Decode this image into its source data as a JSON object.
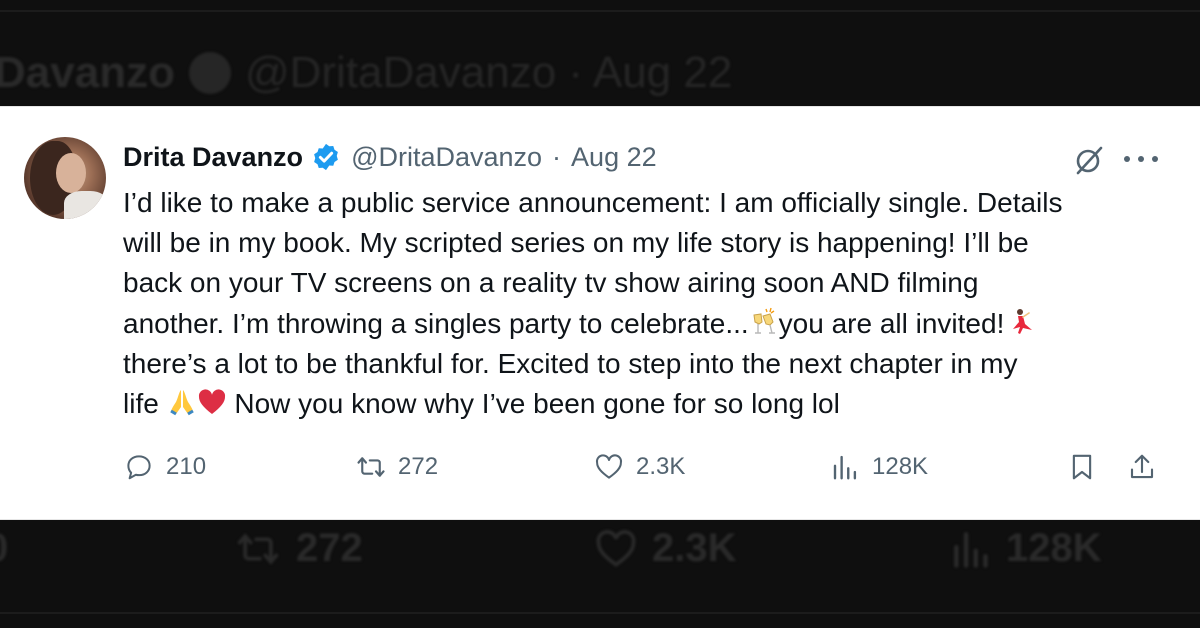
{
  "background": {
    "top_name_fragment": "Davanzo",
    "top_handle_date": "@DritaDavanzo · Aug 22",
    "bottom_reply_fragment": "0",
    "bottom_retweets": "272",
    "bottom_likes": "2.3K",
    "bottom_views": "128K"
  },
  "tweet": {
    "author_name": "Drita Davanzo",
    "handle": "@DritaDavanzo",
    "separator": "·",
    "date": "Aug 22",
    "lines": [
      "I’d like to make a public service announcement: I am officially single. Details",
      "will be in my book. My scripted series on my life story is happening! I’ll be",
      "back on your TV screens on a reality tv show airing soon AND filming",
      "another. I’m throwing a singles party to celebrate...",
      "you are all invited!",
      "there’s a lot to be thankful for. Excited to step into the next chapter in my",
      "life",
      "Now you know why I’ve been gone for so long lol"
    ],
    "emoji": [
      "clinking-glasses",
      "dancer",
      "folded-hands",
      "red-heart"
    ]
  },
  "actions": {
    "replies": "210",
    "retweets": "272",
    "likes": "2.3K",
    "views": "128K"
  },
  "icons": {
    "verified": "verified-badge-icon",
    "grok": "grok-icon",
    "more": "more-icon",
    "reply": "reply-icon",
    "retweet": "retweet-icon",
    "like": "heart-icon",
    "views": "views-icon",
    "bookmark": "bookmark-icon",
    "share": "share-icon"
  },
  "colors": {
    "verified": "#1d9bf0",
    "text": "#0f1419",
    "muted": "#536471",
    "heart": "#e0245e"
  }
}
